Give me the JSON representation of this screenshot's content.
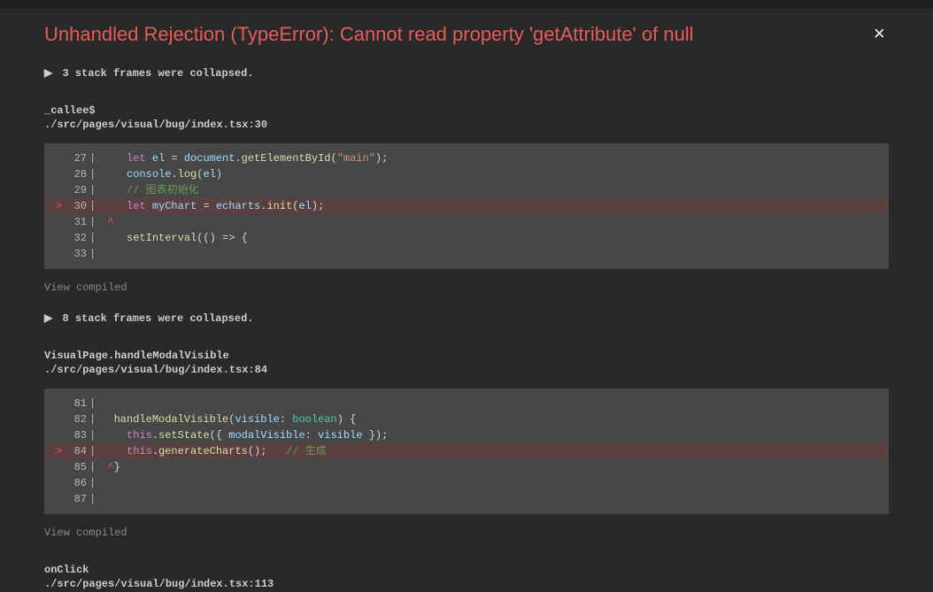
{
  "error_title": "Unhandled Rejection (TypeError): Cannot read property 'getAttribute' of null",
  "close_glyph": "×",
  "arrow_glyph": "▶",
  "collapsed1": "3 stack frames were collapsed.",
  "collapsed2": "8 stack frames were collapsed.",
  "view_compiled": "View compiled",
  "frame1": {
    "func": "_callee$",
    "loc": "./src/pages/visual/bug/index.tsx:30"
  },
  "frame2": {
    "func": "VisualPage.handleModalVisible",
    "loc": "./src/pages/visual/bug/index.tsx:84"
  },
  "frame3": {
    "func": "onClick",
    "loc": "./src/pages/visual/bug/index.tsx:113"
  },
  "code1": {
    "lines": {
      "n27": "27",
      "n28": "28",
      "n29": "29",
      "n30": "30",
      "n31": "31",
      "n32": "32",
      "n33": "33"
    },
    "l27": {
      "kw": "let",
      "v": " el ",
      "eq": "= ",
      "obj": "document",
      "dot": ".",
      "fn": "getElementById",
      "op": "(",
      "str": "\"main\"",
      "cp": ");"
    },
    "l28": {
      "obj": "console",
      "dot": ".",
      "fn": "log",
      "op": "(",
      "arg": "el",
      "cp": ")"
    },
    "l29": {
      "cm": "// 图表初始化"
    },
    "l30": {
      "kw": "let",
      "v": " myChart ",
      "eq": "= ",
      "obj": "echarts",
      "dot": ".",
      "fn": "init",
      "op": "(",
      "arg": "el",
      "cp": ");"
    },
    "l31": {
      "caret": "^"
    },
    "l32": {
      "fn": "setInterval",
      "op": "((",
      "arr": ") => {"
    },
    "gt": ">"
  },
  "code2": {
    "lines": {
      "n81": "81",
      "n82": "82",
      "n83": "83",
      "n84": "84",
      "n85": "85",
      "n86": "86",
      "n87": "87"
    },
    "l82": {
      "fn": "handleModalVisible",
      "op": "(",
      "p1": "visible",
      "col": ": ",
      "ty": "boolean",
      "cp": ") {"
    },
    "l83": {
      "th": "this",
      "dot": ".",
      "fn": "setState",
      "op": "({ ",
      "k": "modalVisible",
      "col": ": ",
      "v": "visible",
      "cp": " });"
    },
    "l84": {
      "th": "this",
      "dot": ".",
      "fn": "generateCharts",
      "op": "()",
      "sc": ";",
      "sp": "   ",
      "cm": "// 生成"
    },
    "l85": {
      "caret": "^",
      "cb": "}"
    },
    "gt": ">"
  }
}
